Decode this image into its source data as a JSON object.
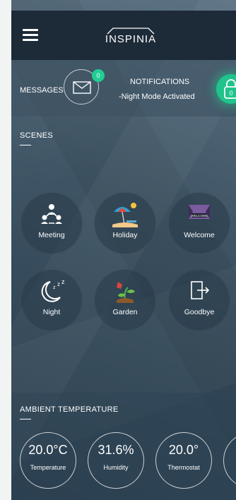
{
  "header": {
    "logo_text": "INSPINIA"
  },
  "status": {
    "messages_label": "MESSAGES",
    "messages_count": "0",
    "notifications_title": "NOTIFICATIONS",
    "notifications_text": "-Night Mode Activated",
    "lock_count": "0"
  },
  "scenes": {
    "title": "SCENES",
    "items": [
      {
        "label": "Meeting",
        "icon": "meeting-icon"
      },
      {
        "label": "Holiday",
        "icon": "holiday-icon"
      },
      {
        "label": "Welcome",
        "icon": "welcome-icon"
      },
      {
        "label": "Night",
        "icon": "night-icon"
      },
      {
        "label": "Garden",
        "icon": "garden-icon"
      },
      {
        "label": "Goodbye",
        "icon": "goodbye-icon"
      }
    ]
  },
  "ambient": {
    "title": "AMBIENT TEMPERATURE",
    "gauges": [
      {
        "value": "20.0°C",
        "label": "Temperature"
      },
      {
        "value": "31.6%",
        "label": "Humidity"
      },
      {
        "value": "20.0°",
        "label": "Thermostat"
      }
    ]
  },
  "colors": {
    "accent": "#1fcf93",
    "header_bg": "#1d2a38"
  }
}
